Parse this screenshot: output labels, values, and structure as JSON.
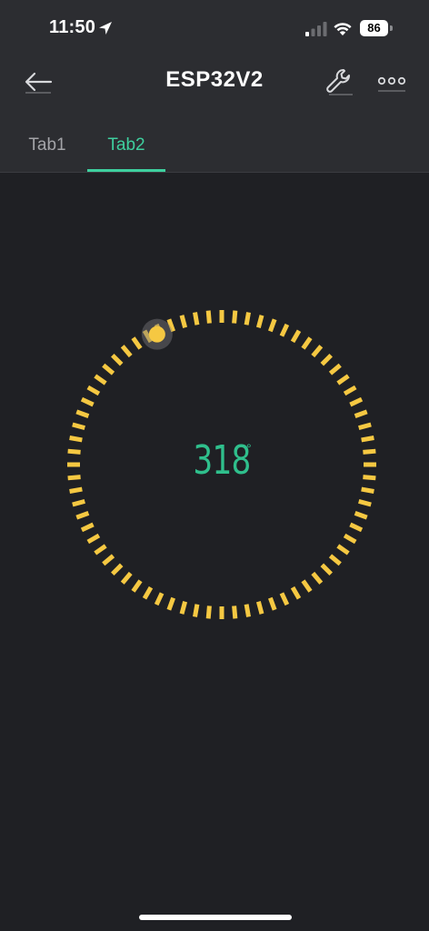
{
  "status_bar": {
    "time": "11:50",
    "battery_level": "86",
    "icons": [
      "location-arrow-icon",
      "cellular-signal-icon",
      "wifi-icon",
      "battery-icon"
    ]
  },
  "nav": {
    "title": "ESP32V2",
    "icons": [
      "back-arrow-icon",
      "wrench-icon",
      "more-dots-icon"
    ]
  },
  "tabs": [
    {
      "label": "Tab1",
      "active": false
    },
    {
      "label": "Tab2",
      "active": true
    }
  ],
  "gauge": {
    "value": "318",
    "unit": "°",
    "min": 0,
    "max": 360,
    "segments": 72,
    "handle_angle": 318
  },
  "colors": {
    "background": "#1f2024",
    "header": "#2c2d31",
    "accent": "#3ecf9e",
    "value_text": "#2fbf8c",
    "gauge_ticks": "#f5c842",
    "inactive_tab": "#a3a4a8"
  }
}
